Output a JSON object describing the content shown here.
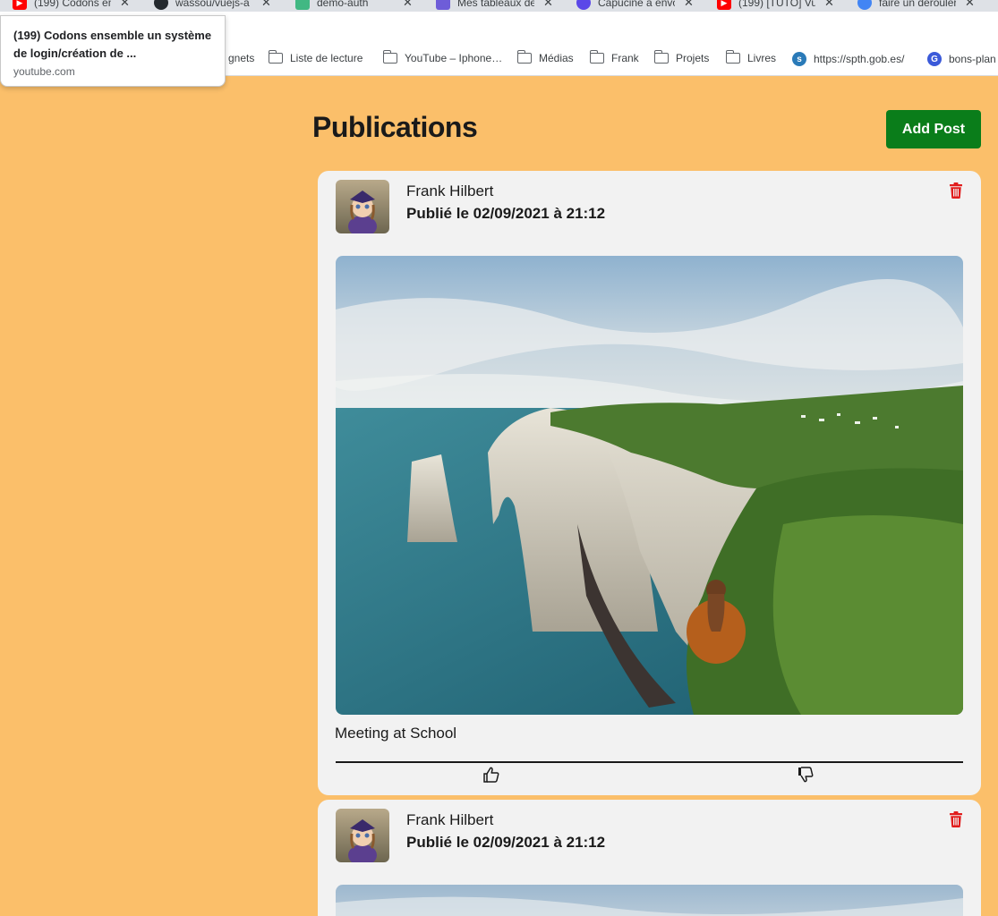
{
  "browser": {
    "tabs": [
      {
        "title": "(199) Codons en",
        "icon": "youtube-icon",
        "color": "#ff0000"
      },
      {
        "title": "wassou/vuejs-a",
        "icon": "github-icon",
        "color": "#24292e"
      },
      {
        "title": "demo-auth",
        "icon": "vue-icon",
        "color": "#41b883"
      },
      {
        "title": "Mes tableaux de",
        "icon": "trello-icon",
        "color": "#6e5dd8"
      },
      {
        "title": "Capucine a envo",
        "icon": "messenger-icon",
        "color": "#5b48e8"
      },
      {
        "title": "(199) [TUTO] Vu",
        "icon": "youtube-icon",
        "color": "#ff0000"
      },
      {
        "title": "faire un dérouler",
        "icon": "google-icon",
        "color": "#4285f4"
      }
    ],
    "tooltip": {
      "title": "(199) Codons ensemble un système de login/création de ...",
      "url": "youtube.com"
    },
    "bookmarks": [
      {
        "label": "gnets",
        "icon": "none"
      },
      {
        "label": "Liste de lecture",
        "icon": "folder-icon"
      },
      {
        "label": "YouTube – Iphone…",
        "icon": "folder-icon"
      },
      {
        "label": "Médias",
        "icon": "folder-icon"
      },
      {
        "label": "Frank",
        "icon": "folder-icon"
      },
      {
        "label": "Projets",
        "icon": "folder-icon"
      },
      {
        "label": "Livres",
        "icon": "folder-icon"
      },
      {
        "label": "https://spth.gob.es/",
        "icon": "spth-icon"
      },
      {
        "label": "bons-plan",
        "icon": "bons-plan-icon"
      }
    ]
  },
  "page": {
    "title": "Publications",
    "add_post_label": "Add Post",
    "accent_color": "#0a7d1a",
    "background_color": "#fbbf6a"
  },
  "posts": [
    {
      "author": "Frank Hilbert",
      "date": "Publié le 02/09/2021 à 21:12",
      "caption": "Meeting at School",
      "image": "etretat-cliffs-photo"
    },
    {
      "author": "Frank Hilbert",
      "date": "Publié le 02/09/2021 à 21:12",
      "image": "etretat-cliffs-photo"
    }
  ]
}
